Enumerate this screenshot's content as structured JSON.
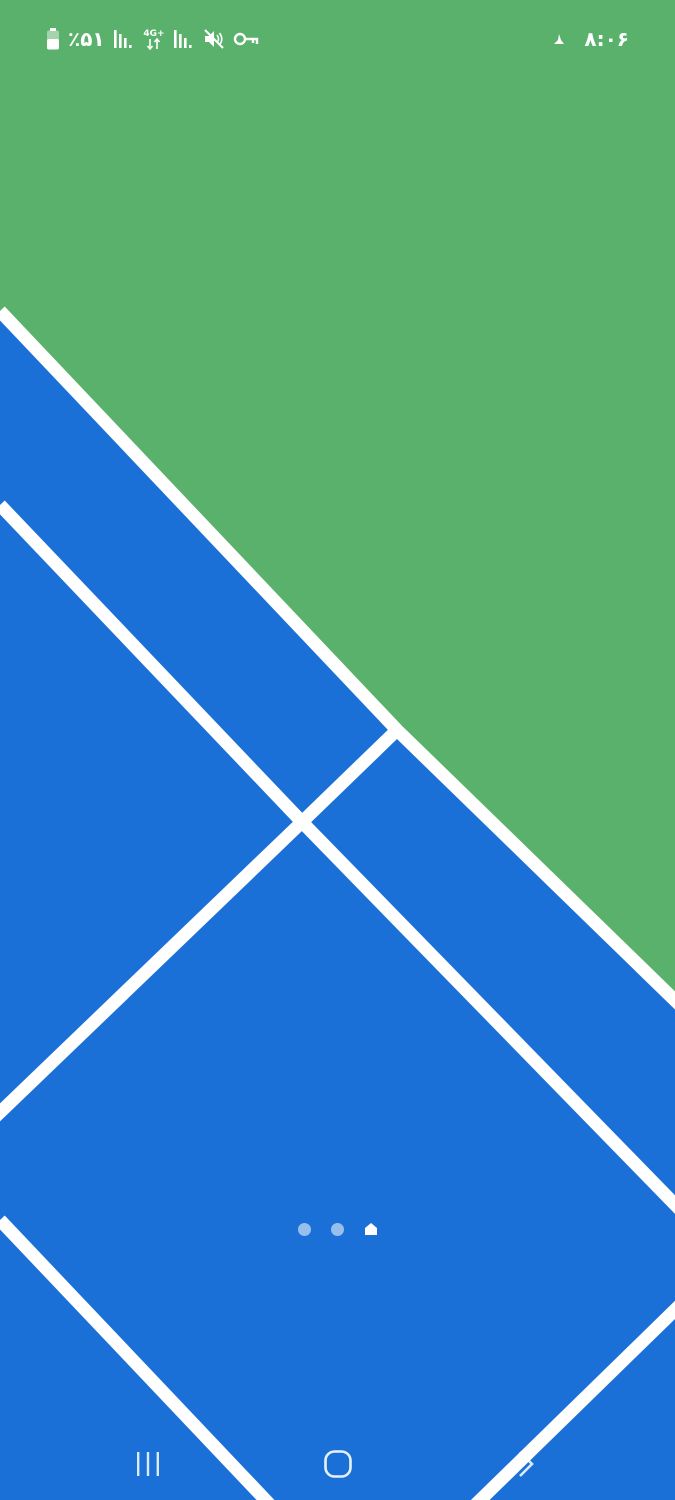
{
  "colors": {
    "wallpaper_green": "#59b16b",
    "wallpaper_blue": "#1b70d8",
    "wallpaper_lines": "#ffffff",
    "status_icons": "#ffffff"
  },
  "status_bar": {
    "battery_percent": "٪۵۱",
    "network_type": "4G+",
    "time": "۸:۰۶",
    "icons": [
      "battery-icon",
      "signal-icon",
      "network-4g-plus-icon",
      "signal-icon",
      "mute-icon",
      "vpn-key-icon",
      "notification-icon"
    ]
  },
  "home_screen": {
    "pages": 3,
    "current_page": 3,
    "indicators": [
      "page-dot",
      "page-dot",
      "home-page-indicator"
    ]
  },
  "navigation_bar": {
    "buttons": [
      "recent-apps-icon",
      "home-icon",
      "back-icon"
    ]
  }
}
